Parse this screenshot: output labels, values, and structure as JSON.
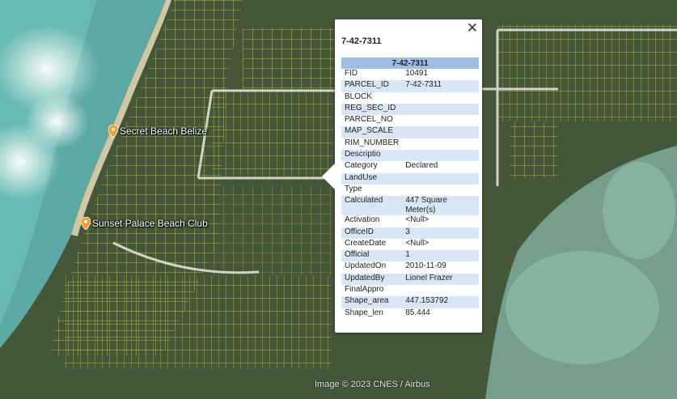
{
  "map": {
    "attribution": "Image © 2023 CNES / Airbus",
    "colors": {
      "sea": "#5aa9a4",
      "land": "#3d4d33",
      "parcel_lines": "#e6e62e",
      "roads": "#e4e0d4"
    },
    "places": [
      {
        "name": "Secret Beach Belize",
        "icon": "place-pin-icon"
      },
      {
        "name": "Sunset Palace Beach Club",
        "icon": "place-pin-icon"
      }
    ]
  },
  "popup": {
    "title": "7-42-7311",
    "header": "7-42-7311",
    "close_icon": "close-icon",
    "rows": [
      {
        "label": "FID",
        "value": "10491"
      },
      {
        "label": "PARCEL_ID",
        "value": "7-42-7311"
      },
      {
        "label": "BLOCK",
        "value": ""
      },
      {
        "label": "REG_SEC_ID",
        "value": ""
      },
      {
        "label": "PARCEL_NO",
        "value": ""
      },
      {
        "label": "MAP_SCALE",
        "value": ""
      },
      {
        "label": "RIM_NUMBER",
        "value": ""
      },
      {
        "label": "Descriptio",
        "value": ""
      },
      {
        "label": "Category",
        "value": "Declared"
      },
      {
        "label": "LandUse",
        "value": ""
      },
      {
        "label": "Type",
        "value": ""
      },
      {
        "label": "Calculated",
        "value": "447 Square Meter(s)"
      },
      {
        "label": "Activation",
        "value": "<Null>"
      },
      {
        "label": "OfficeID",
        "value": "3"
      },
      {
        "label": "CreateDate",
        "value": "<Null>"
      },
      {
        "label": "Official",
        "value": "1"
      },
      {
        "label": "UpdatedOn",
        "value": "2010-11-09"
      },
      {
        "label": "UpdatedBy",
        "value": "Lionel Frazer"
      },
      {
        "label": "FinalAppro",
        "value": ""
      },
      {
        "label": "Shape_area",
        "value": "447.153792"
      },
      {
        "label": "Shape_len",
        "value": "85.444"
      }
    ]
  }
}
